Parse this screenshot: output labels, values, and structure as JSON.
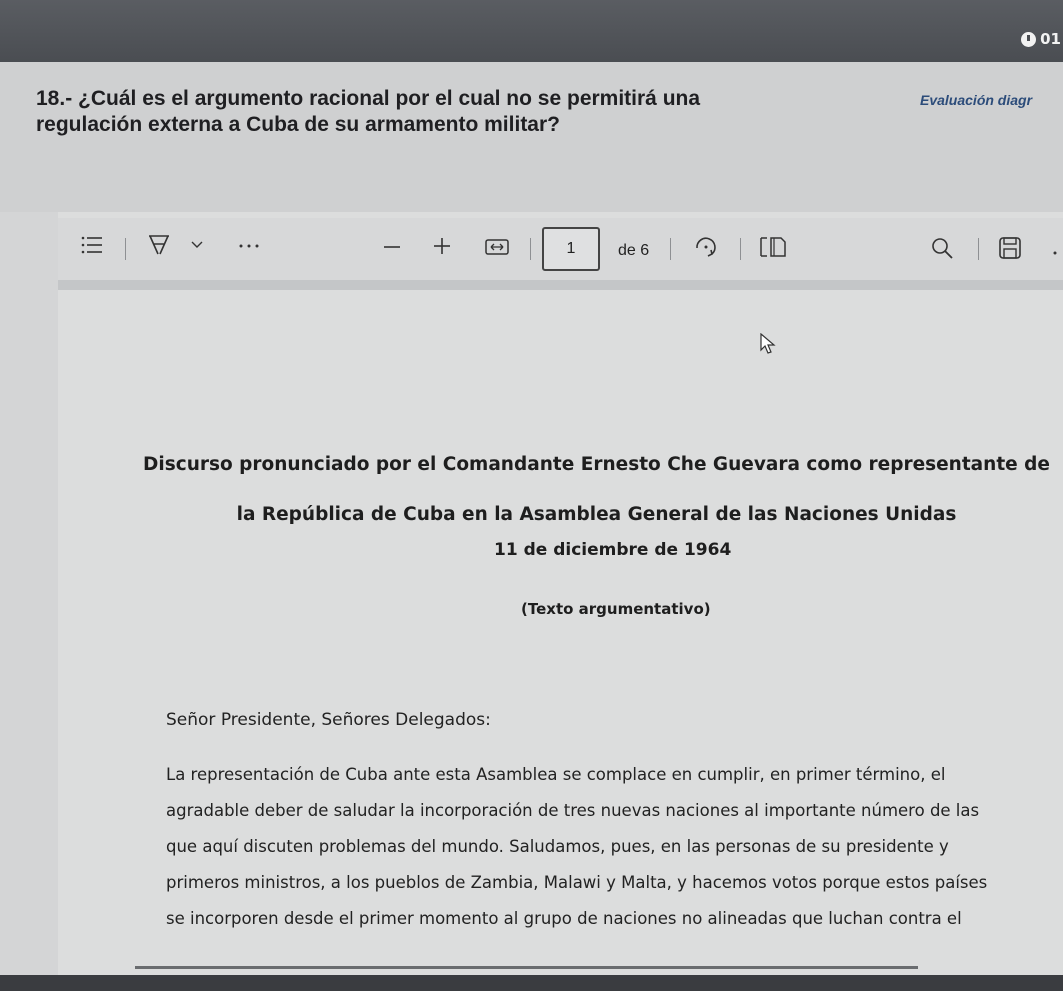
{
  "header": {
    "timer_text": "01"
  },
  "question": {
    "line1": "18.- ¿Cuál es el argumento racional por el cual no se permitirá una",
    "line2": "regulación externa a Cuba de su armamento militar?",
    "eval_label": "Evaluación diagr"
  },
  "toolbar": {
    "page_current": "1",
    "page_total": "de 6",
    "icons": [
      "contents-icon",
      "draw-icon",
      "chevron-down-icon",
      "more-icon",
      "zoom-out-icon",
      "zoom-in-icon",
      "fit-width-icon",
      "rotate-icon",
      "page-view-icon",
      "search-icon",
      "save-icon"
    ]
  },
  "document": {
    "title_line1": "Discurso pronunciado por el Comandante Ernesto Che Guevara como representante de",
    "title_line2": "la República de Cuba en la Asamblea General de las Naciones Unidas",
    "date": "11 de diciembre de 1964",
    "type": "(Texto argumentativo)",
    "salutation": "Señor Presidente, Señores Delegados:",
    "paragraph_lines": [
      "La representación de Cuba ante esta Asamblea se complace en cumplir, en primer término, el",
      "agradable deber de saludar la incorporación de tres nuevas naciones al importante número de las",
      "que aquí discuten problemas del mundo. Saludamos, pues, en las personas de su presidente y",
      "primeros ministros, a los pueblos de Zambia, Malawi y Malta, y hacemos votos porque estos países",
      "se incorporen desde el primer momento al grupo de naciones no alineadas que luchan contra el"
    ]
  }
}
